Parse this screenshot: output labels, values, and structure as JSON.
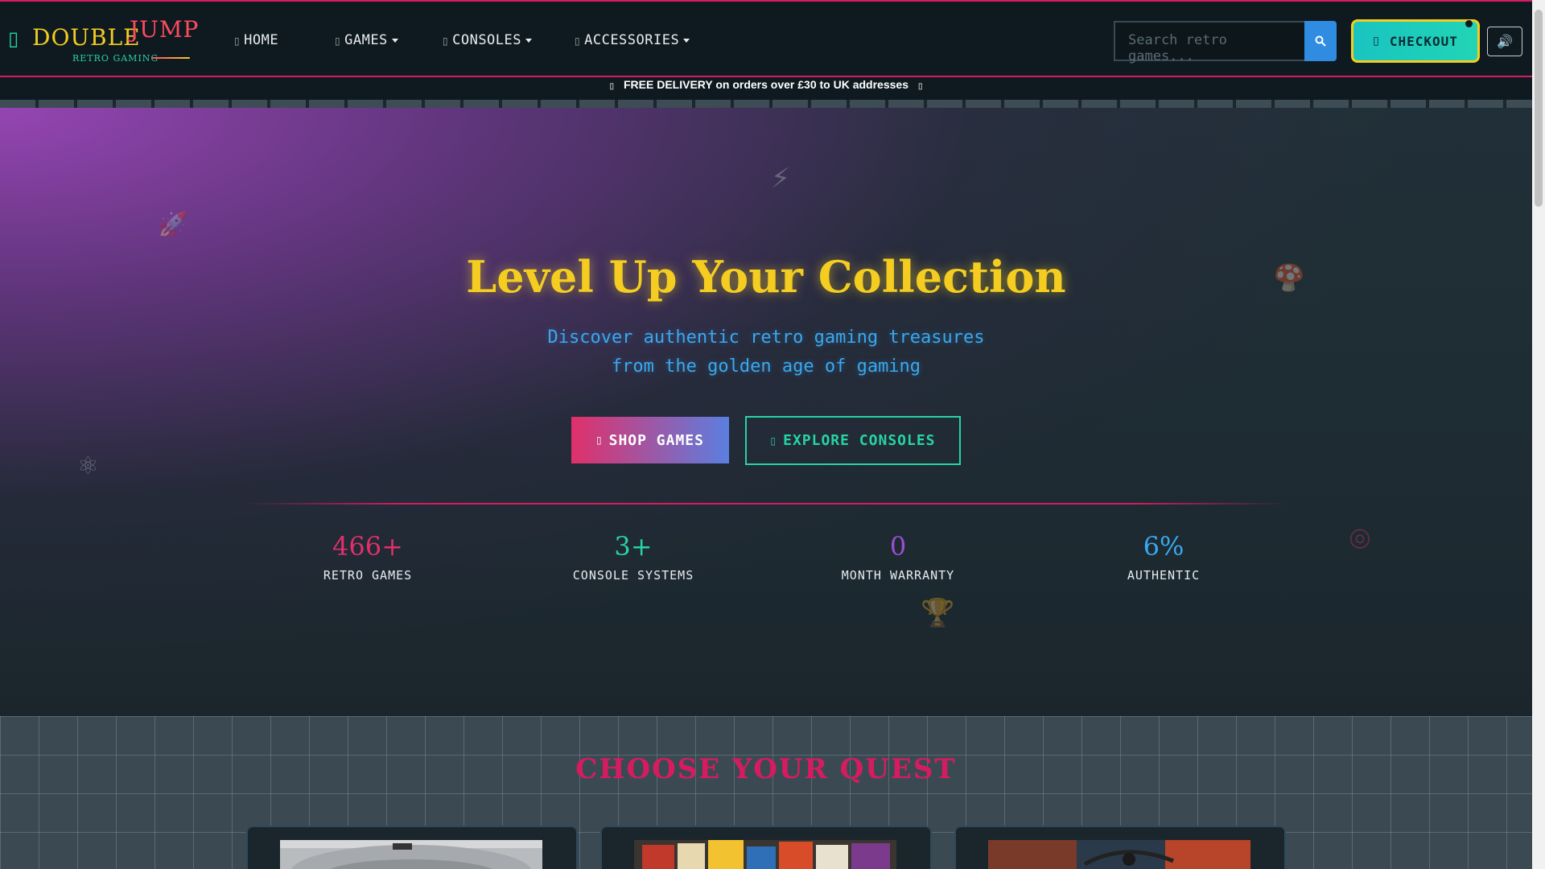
{
  "brand": {
    "icon": "gamepad-icon",
    "word1": "DOUBLE",
    "word2": "JUMP",
    "tagline": "RETRO GAMING"
  },
  "nav": {
    "items": [
      {
        "label": "HOME",
        "icon": "home-icon",
        "dropdown": false
      },
      {
        "label": "GAMES",
        "icon": "gamepad-icon",
        "dropdown": true
      },
      {
        "label": "CONSOLES",
        "icon": "console-icon",
        "dropdown": true
      },
      {
        "label": "ACCESSORIES",
        "icon": "joystick-icon",
        "dropdown": true
      }
    ]
  },
  "search": {
    "placeholder": "Search retro games...",
    "button_icon": "search-icon"
  },
  "checkout": {
    "label": "CHECKOUT",
    "icon": "cart-icon"
  },
  "sound": {
    "icon": "speaker-icon",
    "glyph": "🔊"
  },
  "announcement": {
    "text": "FREE DELIVERY on orders over £30 to UK addresses",
    "icon": "truck-icon"
  },
  "hero": {
    "title": "Level Up Your Collection",
    "subtitle_line1": "Discover authentic retro gaming treasures",
    "subtitle_line2": "from the golden age of gaming",
    "primary_button": "SHOP GAMES",
    "secondary_button": "EXPLORE CONSOLES",
    "decorations": [
      "lightning-icon",
      "rocket-icon",
      "mushroom-icon",
      "atom-icon",
      "target-icon",
      "trophy-icon"
    ]
  },
  "stats": [
    {
      "value": "466+",
      "label": "RETRO GAMES",
      "color": "#e0306a"
    },
    {
      "value": "3+",
      "label": "CONSOLE SYSTEMS",
      "color": "#27d3a3"
    },
    {
      "value": "0",
      "label": "MONTH WARRANTY",
      "color": "#9b4fd1"
    },
    {
      "value": "6%",
      "label": "AUTHENTIC",
      "color": "#3aa8f0"
    }
  ],
  "quest": {
    "title": "CHOOSE YOUR QUEST"
  },
  "colors": {
    "accent_pink": "#d81b60",
    "accent_gold": "#f4cd20",
    "accent_teal": "#27d3a3",
    "accent_blue": "#3aa8f0",
    "nav_bg": "#0f1a20"
  }
}
